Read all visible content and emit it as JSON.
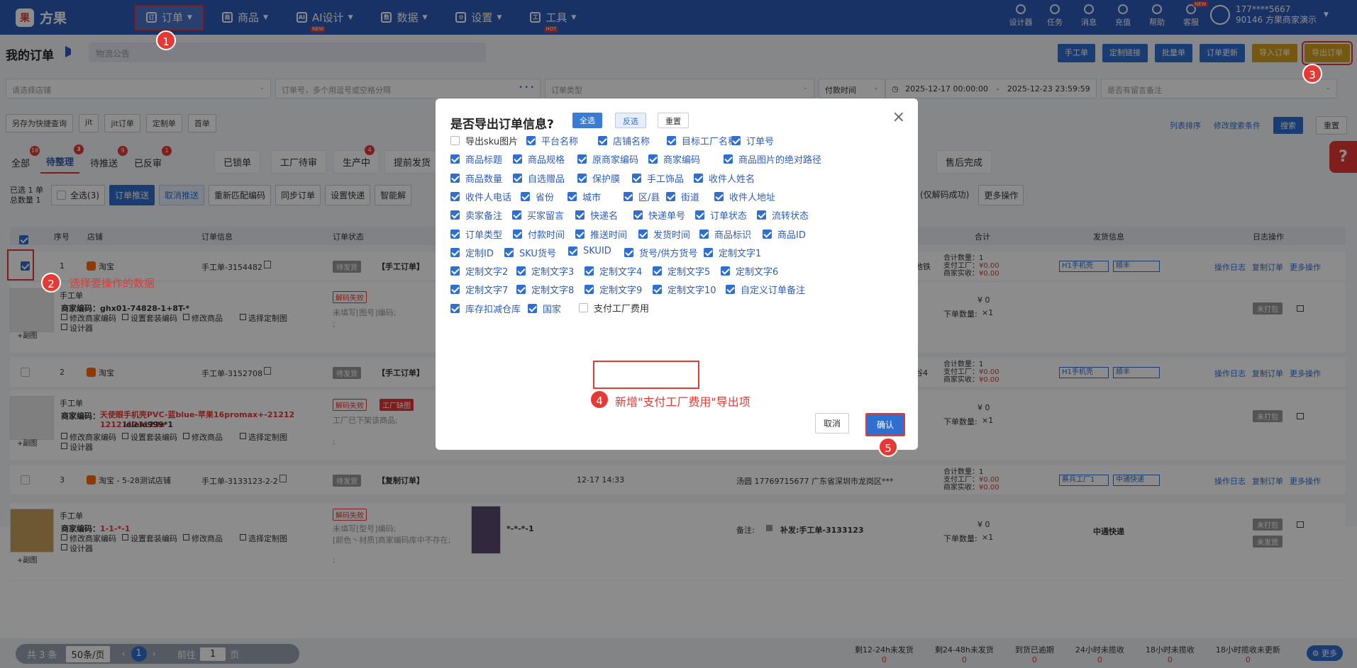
{
  "app": {
    "logo_text": "方果",
    "logo_mark": "果"
  },
  "nav": [
    {
      "label": "订单",
      "icon": "order-icon"
    },
    {
      "label": "商品",
      "icon": "goods-icon"
    },
    {
      "label": "AI设计",
      "icon": "ai-icon",
      "badge": "NEW"
    },
    {
      "label": "数据",
      "icon": "chart-icon"
    },
    {
      "label": "设置",
      "icon": "gear-icon"
    },
    {
      "label": "工具",
      "icon": "toolbox-icon",
      "badge": "HOT"
    }
  ],
  "tools": [
    "设计器",
    "任务",
    "消息",
    "充值",
    "帮助",
    "客服"
  ],
  "tools_badge": "NEW",
  "user": {
    "phone": "177****5667",
    "name": "90146 方果商家演示"
  },
  "page": {
    "title": "我的订单",
    "notice_placeholder": "物流公告"
  },
  "top_buttons": [
    "手工单",
    "定制链接",
    "批量单",
    "订单更新",
    "导入订单",
    "导出订单"
  ],
  "filters": {
    "shop": "请选择店铺",
    "order_no": "订单号，多个用逗号或空格分隔",
    "order_type": "订单类型",
    "time_type": "付款时间",
    "date_start": "2025-12-17 00:00:00",
    "date_sep": "-",
    "date_end": "2025-12-23 23:59:59",
    "remark": "是否有留言备注"
  },
  "quick_chips": [
    "另存为快捷查询",
    "jit",
    "jit订单",
    "定制单",
    "首单"
  ],
  "right_actions": {
    "sort": "列表排序",
    "modify": "修改搜索条件",
    "search": "搜索",
    "reset": "重置"
  },
  "tabs": [
    {
      "label": "全部",
      "count": "18"
    },
    {
      "label": "待整理",
      "count": "3"
    },
    {
      "label": "待推送",
      "count": "9"
    },
    {
      "label": "已反审",
      "count": "1"
    }
  ],
  "tabs2": [
    {
      "label": "已锁单"
    },
    {
      "label": "工厂待审"
    },
    {
      "label": "生产中",
      "count": "4"
    },
    {
      "label": "提前发货"
    },
    {
      "label": "售后完成"
    }
  ],
  "selection": {
    "line1": "已选 1 单",
    "line2": "总数量 1"
  },
  "action_bar": [
    "全选(3)",
    "订单推送",
    "取消推送",
    "重新匹配编码",
    "同步订单",
    "设置快递",
    "智能解"
  ],
  "action_bar_right": [
    "(仅解码成功)",
    "更多操作"
  ],
  "table_headers": [
    "序号",
    "店铺",
    "订单信息",
    "订单状态",
    "合计",
    "发货信息",
    "日志操作"
  ],
  "orders": [
    {
      "idx": "1",
      "shop": "淘宝",
      "order": "手工单-3154482",
      "status": "待发货",
      "tag": "【手工订单】",
      "sum_qty": "合计数量：1",
      "sum_factory": "支付工厂：",
      "sum_factory_v": "¥0.00",
      "sum_real": "商家实收：",
      "sum_real_v": "¥0.00",
      "ship1": "H1手机壳",
      "ship2": "顺丰",
      "ops": [
        "操作日志",
        "复制订单",
        "更多操作"
      ],
      "side": "地铁"
    },
    {
      "idx": "2",
      "shop": "淘宝",
      "order": "手工单-3152708",
      "status": "待发货",
      "tag": "【手工订单】",
      "sum_qty": "合计数量：1",
      "sum_factory": "支付工厂：",
      "sum_factory_v": "¥0.00",
      "sum_real": "商家实收：",
      "sum_real_v": "¥0.00",
      "ship1": "H1手机壳",
      "ship2": "顺丰",
      "ops": [
        "操作日志",
        "复制订单",
        "更多操作"
      ],
      "side": "谷4"
    },
    {
      "idx": "3",
      "shop": "淘宝 - 5-28测试店铺",
      "order": "手工单-3133123-2-2",
      "status": "待发货",
      "tag": "【复制订单】",
      "time": "12-17 14:33",
      "addr": "汤圆 17769715677 广东省深圳市龙岗区***",
      "sum_qty": "合计数量：1",
      "sum_factory": "支付工厂：",
      "sum_factory_v": "¥0.00",
      "sum_real": "商家实收：",
      "sum_real_v": "¥0.00",
      "ship1": "蔡兵工厂1",
      "ship2": "中通快递",
      "ops": [
        "操作日志",
        "复制订单",
        "更多操作"
      ]
    }
  ],
  "details": [
    {
      "kind": "手工单",
      "code_label": "商家编码：",
      "code": "ghx01-74828-1+8T-*",
      "links": [
        "修改商家编码",
        "设置套装编码",
        "修改商品",
        "选择定制图",
        "设计器"
      ],
      "addpic": "+副图",
      "status": "解码失败",
      "note": "未填写[图号]编码;",
      "note2": ";",
      "price": "¥ 0",
      "qty_label": "下单数量:",
      "qty": "×1",
      "pack": "未打包"
    },
    {
      "kind": "手工单",
      "code_label": "商家编码：",
      "code": "天使眼手机壳PVC-蓝blue-苹果16promax+-21212 12121123123e",
      "code2": "lelele999*1",
      "links": [
        "修改商家编码",
        "设置套装编码",
        "修改商品",
        "选择定制图",
        "设计器"
      ],
      "addpic": "+副图",
      "status": "解码失败",
      "status2": "工厂缺图",
      "note": "工厂已下架该商品;",
      "note2": ";",
      "price": "¥ 0",
      "qty_label": "下单数量:",
      "qty": "×1",
      "pack": "未打包"
    },
    {
      "kind": "手工单",
      "code_label": "商家编码：",
      "code": "1-1-*-1",
      "links": [
        "修改商家编码",
        "设置套装编码",
        "修改商品",
        "选择定制图",
        "设计器"
      ],
      "addpic": "+副图",
      "status": "解码失败",
      "note": "未填写[型号]编码;",
      "note2": "[颜色丶材质]商家编码库中不存在;",
      "note3": ";",
      "goods_code": "*-*-*-1",
      "remark_label": "备注:",
      "remark": "补发:手工单-3133123",
      "price": "¥ 0",
      "qty_label": "下单数量:",
      "qty": "×1",
      "express": "中通快递",
      "pack": "未打包",
      "pack2": "未发货"
    }
  ],
  "annotations": {
    "a1": "1",
    "a2": "2",
    "a2_text": "选择要操作的数据",
    "a3": "3",
    "a4": "4",
    "a4_text": "新增\"支付工厂费用\"导出项",
    "a5": "5"
  },
  "modal": {
    "title": "是否导出订单信息?",
    "btn_all": "全选",
    "btn_invert": "反选",
    "btn_reset": "重置",
    "close": "×",
    "cancel": "取消",
    "confirm": "确认",
    "options": [
      {
        "label": "导出sku图片",
        "checked": false
      },
      {
        "label": "平台名称",
        "checked": true
      },
      {
        "label": "店铺名称",
        "checked": true
      },
      {
        "label": "目标工厂名称",
        "checked": true
      },
      {
        "label": "订单号",
        "checked": true
      },
      {
        "label": "商品标题",
        "checked": true
      },
      {
        "label": "商品规格",
        "checked": true
      },
      {
        "label": "原商家编码",
        "checked": true
      },
      {
        "label": "商家编码",
        "checked": true
      },
      {
        "label": "商品图片的绝对路径",
        "checked": true
      },
      {
        "label": "商品数量",
        "checked": true
      },
      {
        "label": "自选赠品",
        "checked": true
      },
      {
        "label": "保护膜",
        "checked": true
      },
      {
        "label": "手工饰品",
        "checked": true
      },
      {
        "label": "收件人姓名",
        "checked": true
      },
      {
        "label": "收件人电话",
        "checked": true
      },
      {
        "label": "省份",
        "checked": true
      },
      {
        "label": "城市",
        "checked": true
      },
      {
        "label": "区/县",
        "checked": true
      },
      {
        "label": "街道",
        "checked": true
      },
      {
        "label": "收件人地址",
        "checked": true
      },
      {
        "label": "卖家备注",
        "checked": true
      },
      {
        "label": "买家留言",
        "checked": true
      },
      {
        "label": "快递名",
        "checked": true
      },
      {
        "label": "快递单号",
        "checked": true
      },
      {
        "label": "订单状态",
        "checked": true
      },
      {
        "label": "流转状态",
        "checked": true
      },
      {
        "label": "订单类型",
        "checked": true
      },
      {
        "label": "付款时间",
        "checked": true
      },
      {
        "label": "推送时间",
        "checked": true
      },
      {
        "label": "发货时间",
        "checked": true
      },
      {
        "label": "商品标识",
        "checked": true
      },
      {
        "label": "商品ID",
        "checked": true
      },
      {
        "label": "定制ID",
        "checked": true
      },
      {
        "label": "SKU货号",
        "checked": true
      },
      {
        "label": "SKUID",
        "checked": true
      },
      {
        "label": "货号/供方货号",
        "checked": true
      },
      {
        "label": "定制文字1",
        "checked": true
      },
      {
        "label": "定制文字2",
        "checked": true
      },
      {
        "label": "定制文字3",
        "checked": true
      },
      {
        "label": "定制文字4",
        "checked": true
      },
      {
        "label": "定制文字5",
        "checked": true
      },
      {
        "label": "定制文字6",
        "checked": true
      },
      {
        "label": "定制文字7",
        "checked": true
      },
      {
        "label": "定制文字8",
        "checked": true
      },
      {
        "label": "定制文字9",
        "checked": true
      },
      {
        "label": "定制文字10",
        "checked": true
      },
      {
        "label": "自定义订单备注",
        "checked": true
      },
      {
        "label": "库存扣减仓库",
        "checked": true
      },
      {
        "label": "国家",
        "checked": true
      },
      {
        "label": "支付工厂费用",
        "checked": false
      }
    ]
  },
  "footer": {
    "total": "共 3 条",
    "page_size": "50条/页",
    "page": "1",
    "goto_label": "前往",
    "goto_value": "1",
    "page_suffix": "页",
    "stats": [
      {
        "label": "剩12-24h未发货",
        "value": "0"
      },
      {
        "label": "剩24-48h未发货",
        "value": "0"
      },
      {
        "label": "到货已逾期",
        "value": "0"
      },
      {
        "label": "24小时未揽收",
        "value": "0"
      },
      {
        "label": "18小时未揽收",
        "value": "0"
      },
      {
        "label": "18小时揽收未更新",
        "value": "0"
      }
    ],
    "more": "更多"
  },
  "help_glyph": "?"
}
